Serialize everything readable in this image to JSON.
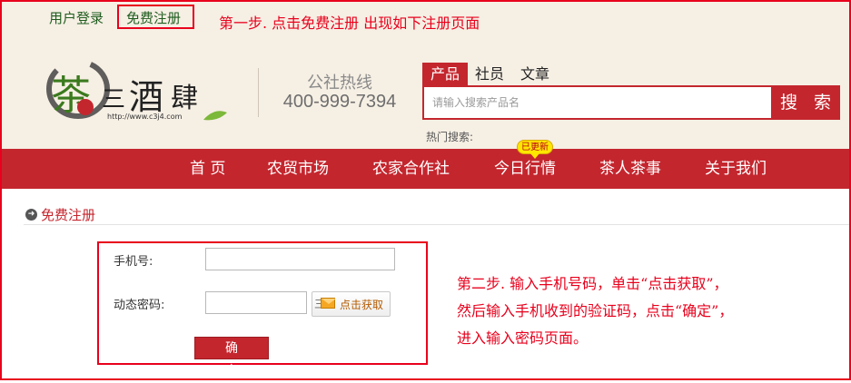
{
  "topbar": {
    "login": "用户登录",
    "register": "免费注册",
    "step1_note": "第一步. 点击免费注册  出现如下注册页面"
  },
  "logo": {
    "name": "茶三酒肆",
    "url_text": "http://www.c3j4.com"
  },
  "hotline": {
    "label": "公社热线",
    "number": "400-999-7394"
  },
  "search": {
    "tabs": [
      "产品",
      "社员",
      "文章"
    ],
    "placeholder": "请输入搜索产品名",
    "button": "搜 索",
    "hot_label": "热门搜索:"
  },
  "nav": {
    "items": [
      "首 页",
      "农贸市场",
      "农家合作社",
      "今日行情",
      "茶人茶事",
      "关于我们"
    ],
    "badge": "已更新"
  },
  "section": {
    "icon": "arrow-right-circle-icon",
    "title": "免费注册"
  },
  "form": {
    "phone_label": "手机号:",
    "code_label": "动态密码:",
    "phone_value": "",
    "code_value": "",
    "get_code_prefix": "三",
    "get_code": "点击获取",
    "mail_icon": "mail-icon",
    "confirm": "确 定"
  },
  "step2_note": [
    "第二步. 输入手机号码，单击“点击获取”，",
    "然后输入手机收到的验证码，点击“确定”，",
    "进入输入密码页面。"
  ],
  "colors": {
    "brand_red": "#c4262e",
    "annotation_red": "#e8001c",
    "header_bg": "#f6efe4",
    "link_green": "#1f5d1f"
  }
}
